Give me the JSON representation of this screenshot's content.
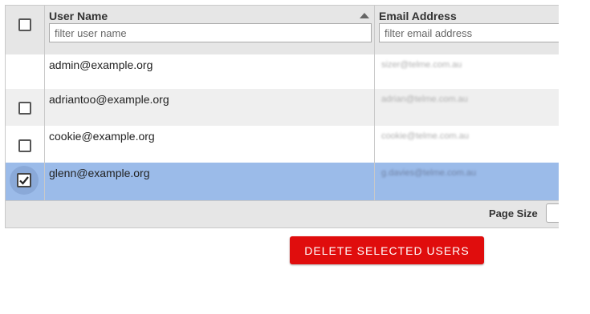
{
  "grid": {
    "columns": {
      "user_name": {
        "title": "User Name",
        "filter_placeholder": "filter user name",
        "sort": "ascending"
      },
      "email": {
        "title": "Email Address",
        "filter_placeholder": "filter email address"
      }
    },
    "rows": [
      {
        "user": "admin@example.org",
        "email": "sizer@telme.com.au",
        "selected": false,
        "show_checkbox": false
      },
      {
        "user": "adriantoo@example.org",
        "email": "adrian@telme.com.au",
        "selected": false,
        "show_checkbox": true
      },
      {
        "user": "cookie@example.org",
        "email": "cookie@telme.com.au",
        "selected": false,
        "show_checkbox": true
      },
      {
        "user": "glenn@example.org",
        "email": "g.davies@telme.com.au",
        "selected": true,
        "show_checkbox": true
      }
    ],
    "footer": {
      "page_size_label": "Page Size"
    }
  },
  "actions": {
    "delete_label": "DELETE SELECTED USERS"
  },
  "colors": {
    "header_bg": "#e6e6e6",
    "row_alt_bg": "#efefef",
    "row_selected_bg": "#9bbbe9",
    "delete_button": "#e00d0d"
  },
  "icons": [
    "select-all-checkbox",
    "sort-ascending-icon",
    "row-checkbox",
    "checkmark-icon",
    "page-size-dropdown"
  ]
}
